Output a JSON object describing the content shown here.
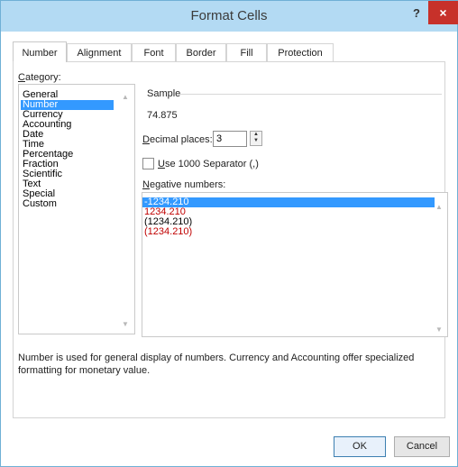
{
  "window": {
    "title": "Format Cells",
    "help_label": "?",
    "close_label": "×"
  },
  "tabs": [
    {
      "label": "Number"
    },
    {
      "label": "Alignment"
    },
    {
      "label": "Font"
    },
    {
      "label": "Border"
    },
    {
      "label": "Fill"
    },
    {
      "label": "Protection"
    }
  ],
  "category": {
    "label_prefix": "C",
    "label_rest": "ategory:",
    "items": [
      "General",
      "Number",
      "Currency",
      "Accounting",
      "Date",
      "Time",
      "Percentage",
      "Fraction",
      "Scientific",
      "Text",
      "Special",
      "Custom"
    ],
    "selected": "Number"
  },
  "sample": {
    "label": "Sample",
    "value": "74.875"
  },
  "decimal_places": {
    "label_prefix": "D",
    "label_rest": "ecimal places:",
    "value": "3"
  },
  "separator": {
    "label_prefix": "U",
    "label_rest": "se 1000 Separator (,)",
    "checked": false
  },
  "negative_numbers": {
    "label_prefix": "N",
    "label_rest": "egative numbers:",
    "items": [
      {
        "text": "-1234.210",
        "color": "#000000"
      },
      {
        "text": "1234.210",
        "color": "#c00000"
      },
      {
        "text": "(1234.210)",
        "color": "#000000"
      },
      {
        "text": "(1234.210)",
        "color": "#c00000"
      }
    ],
    "selected_index": 0,
    "selection_color": "#3399ff"
  },
  "description": "Number is used for general display of numbers.  Currency and Accounting offer specialized formatting for monetary value.",
  "buttons": {
    "ok": "OK",
    "cancel": "Cancel"
  }
}
